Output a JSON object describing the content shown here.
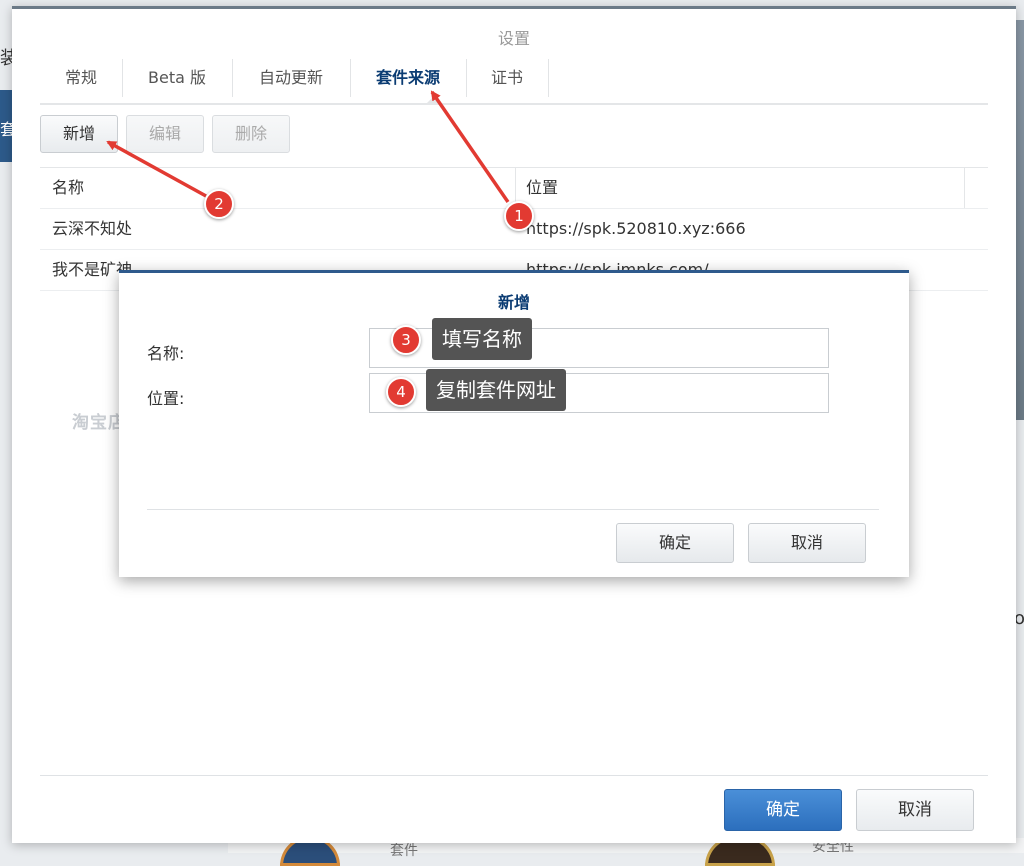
{
  "background": {
    "left_text": "装",
    "left_bar_text": "套",
    "right_char": "o",
    "bottom_left_text": "套件",
    "bottom_right_text": "安全性"
  },
  "window": {
    "title": "设置",
    "tabs": [
      {
        "label": "常规",
        "active": false
      },
      {
        "label": "Beta 版",
        "active": false
      },
      {
        "label": "自动更新",
        "active": false
      },
      {
        "label": "套件来源",
        "active": true
      },
      {
        "label": "证书",
        "active": false
      }
    ],
    "toolbar": {
      "add_label": "新增",
      "edit_label": "编辑",
      "delete_label": "删除"
    },
    "table": {
      "columns": [
        "名称",
        "位置"
      ],
      "rows": [
        {
          "name": "云深不知处",
          "location": "https://spk.520810.xyz:666"
        },
        {
          "name": "我不是矿神",
          "location": "https://spk.imnks.com/"
        }
      ]
    },
    "ok_label": "确定",
    "cancel_label": "取消"
  },
  "modal": {
    "title": "新增",
    "name_label": "名称:",
    "name_value": "",
    "location_label": "位置:",
    "location_value": "",
    "ok_label": "确定",
    "cancel_label": "取消"
  },
  "watermark": "淘宝店：tank电玩",
  "annotations": {
    "badges": [
      "1",
      "2",
      "3",
      "4"
    ],
    "tooltip_name": "填写名称",
    "tooltip_location": "复制套件网址",
    "color": "#e23a32"
  },
  "colors": {
    "accent": "#0b3c73",
    "primary_button": "#2c6fbd",
    "modal_border": "#2e5a8c"
  }
}
